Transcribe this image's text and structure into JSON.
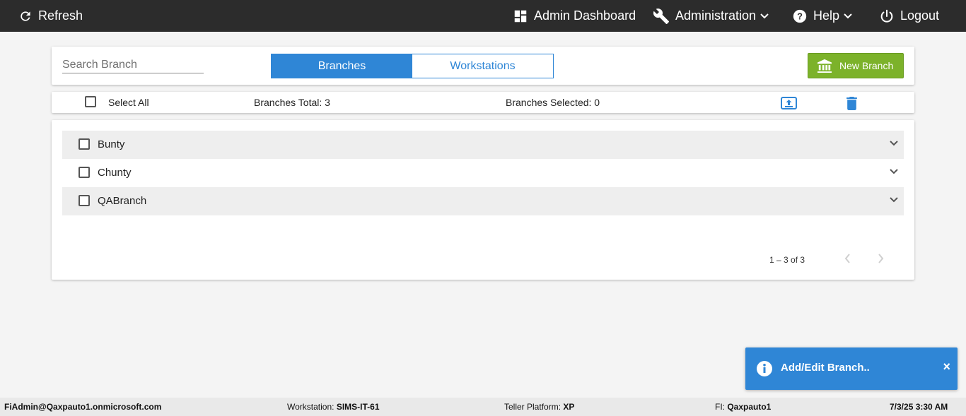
{
  "topbar": {
    "refresh_label": "Refresh",
    "admin_dashboard_label": "Admin Dashboard",
    "administration_label": "Administration",
    "help_label": "Help",
    "logout_label": "Logout",
    "background": "#2c2c2c"
  },
  "search": {
    "placeholder": "Search Branch",
    "value": ""
  },
  "tabs": [
    {
      "label": "Branches",
      "active": true
    },
    {
      "label": "Workstations",
      "active": false
    }
  ],
  "new_branch": {
    "label": "New Branch",
    "icon": "bank-icon",
    "color": "#7cb22a"
  },
  "bar": {
    "select_all_label": "Select All",
    "branches_total": "Branches Total: 3",
    "branches_selected": "Branches Selected: 0",
    "upload_icon": "upload-icon",
    "delete_icon": "trash-icon"
  },
  "branches": [
    {
      "name": "Bunty",
      "checked": false
    },
    {
      "name": "Chunty",
      "checked": false
    },
    {
      "name": "QABranch",
      "checked": false
    }
  ],
  "pager": {
    "range": "1 – 3 of 3"
  },
  "toast": {
    "message": "Add/Edit Branch..",
    "close": "×",
    "color": "#2f86d6"
  },
  "status": {
    "user": "FiAdmin@Qaxpauto1.onmicrosoft.com",
    "workstation_label": "Workstation:",
    "workstation_value": "SIMS-IT-61",
    "platform_label": "Teller Platform:",
    "platform_value": "XP",
    "fi_label": "FI:",
    "fi_value": "Qaxpauto1",
    "datetime": "7/3/25 3:30 AM"
  },
  "accent": "#2f86d6"
}
